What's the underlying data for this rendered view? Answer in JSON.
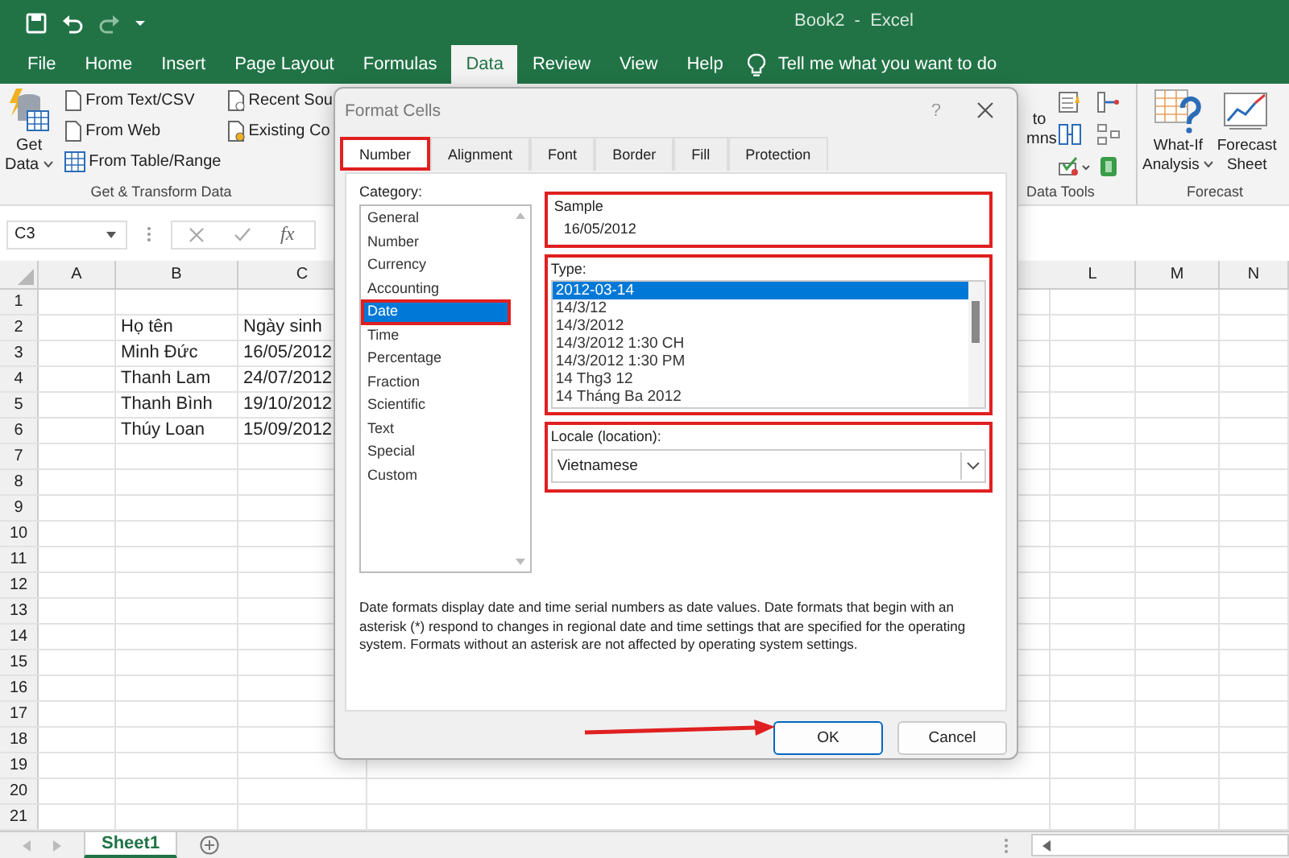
{
  "window": {
    "title": "Book2  -  Excel"
  },
  "ribbon_tabs": [
    {
      "label": "File",
      "selected": false
    },
    {
      "label": "Home",
      "selected": false
    },
    {
      "label": "Insert",
      "selected": false
    },
    {
      "label": "Page Layout",
      "selected": false
    },
    {
      "label": "Formulas",
      "selected": false
    },
    {
      "label": "Data",
      "selected": true
    },
    {
      "label": "Review",
      "selected": false
    },
    {
      "label": "View",
      "selected": false
    },
    {
      "label": "Help",
      "selected": false
    }
  ],
  "tell_me": {
    "placeholder": "Tell me what you want to do"
  },
  "ribbon": {
    "get_data": {
      "line1": "Get",
      "line2": "Data"
    },
    "small_buttons": [
      "From Text/CSV",
      "From Web",
      "From Table/Range"
    ],
    "small_buttons_2": [
      "Recent Sou",
      "Existing Co"
    ],
    "group_1": "Get & Transform Data",
    "text_to_columns_cut": [
      "to",
      "mns"
    ],
    "group_2": "Data Tools",
    "what_if": [
      "What-If",
      "Analysis"
    ],
    "forecast_sheet": [
      "Forecast",
      "Sheet"
    ],
    "group_3": "Forecast"
  },
  "formula_bar": {
    "name_box": "C3",
    "fx": "fx"
  },
  "grid": {
    "columns": [
      "A",
      "B",
      "C",
      "L",
      "M",
      "N"
    ],
    "rows": [
      {
        "number": "1"
      },
      {
        "number": "2",
        "cells": [
          "Họ tên",
          "Ngày sinh"
        ]
      },
      {
        "number": "3",
        "cells": [
          "Minh Đức",
          "16/05/2012"
        ]
      },
      {
        "number": "4",
        "cells": [
          "Thanh Lam",
          "24/07/2012"
        ]
      },
      {
        "number": "5",
        "cells": [
          "Thanh Bình",
          "19/10/2012"
        ]
      },
      {
        "number": "6",
        "cells": [
          "Thúy Loan",
          "15/09/2012"
        ]
      },
      {
        "number": "7"
      },
      {
        "number": "8"
      },
      {
        "number": "9"
      },
      {
        "number": "10"
      },
      {
        "number": "11"
      },
      {
        "number": "12"
      },
      {
        "number": "13"
      },
      {
        "number": "14"
      },
      {
        "number": "15"
      },
      {
        "number": "16"
      },
      {
        "number": "17"
      },
      {
        "number": "18"
      },
      {
        "number": "19"
      },
      {
        "number": "20"
      },
      {
        "number": "21"
      }
    ]
  },
  "sheet_tabs": [
    {
      "label": "Sheet1",
      "selected": true
    }
  ],
  "dialog": {
    "title": "Format Cells",
    "help": "?",
    "tabs": [
      {
        "label": "Number",
        "selected": true,
        "highlighted": true
      },
      {
        "label": "Alignment",
        "selected": false,
        "highlighted": false
      },
      {
        "label": "Font",
        "selected": false,
        "highlighted": false
      },
      {
        "label": "Border",
        "selected": false,
        "highlighted": false
      },
      {
        "label": "Fill",
        "selected": false,
        "highlighted": false
      },
      {
        "label": "Protection",
        "selected": false,
        "highlighted": false
      }
    ],
    "category_label": "Category:",
    "categories": [
      {
        "label": "General",
        "selected": false,
        "highlighted": false
      },
      {
        "label": "Number",
        "selected": false,
        "highlighted": false
      },
      {
        "label": "Currency",
        "selected": false,
        "highlighted": false
      },
      {
        "label": "Accounting",
        "selected": false,
        "highlighted": false
      },
      {
        "label": "Date",
        "selected": true,
        "highlighted": true
      },
      {
        "label": "Time",
        "selected": false,
        "highlighted": false
      },
      {
        "label": "Percentage",
        "selected": false,
        "highlighted": false
      },
      {
        "label": "Fraction",
        "selected": false,
        "highlighted": false
      },
      {
        "label": "Scientific",
        "selected": false,
        "highlighted": false
      },
      {
        "label": "Text",
        "selected": false,
        "highlighted": false
      },
      {
        "label": "Special",
        "selected": false,
        "highlighted": false
      },
      {
        "label": "Custom",
        "selected": false,
        "highlighted": false
      }
    ],
    "sample": {
      "label": "Sample",
      "value": "16/05/2012",
      "highlighted": true
    },
    "type": {
      "label": "Type:",
      "highlighted": true,
      "items": [
        {
          "label": "2012-03-14",
          "selected": true
        },
        {
          "label": "14/3/12",
          "selected": false
        },
        {
          "label": "14/3/2012",
          "selected": false
        },
        {
          "label": "14/3/2012 1:30 CH",
          "selected": false
        },
        {
          "label": "14/3/2012 1:30 PM",
          "selected": false
        },
        {
          "label": "14 Thg3 12",
          "selected": false
        },
        {
          "label": "14 Tháng Ba 2012",
          "selected": false
        }
      ]
    },
    "locale": {
      "label": "Locale (location):",
      "value": "Vietnamese",
      "highlighted": true
    },
    "description": "Date formats display date and time serial numbers as date values.  Date formats that begin with an asterisk (*) respond to changes in regional date and time settings that are specified for the operating system. Formats without an asterisk are not affected by operating system settings.",
    "buttons": [
      "OK",
      "Cancel"
    ],
    "annotation_arrow": true
  }
}
